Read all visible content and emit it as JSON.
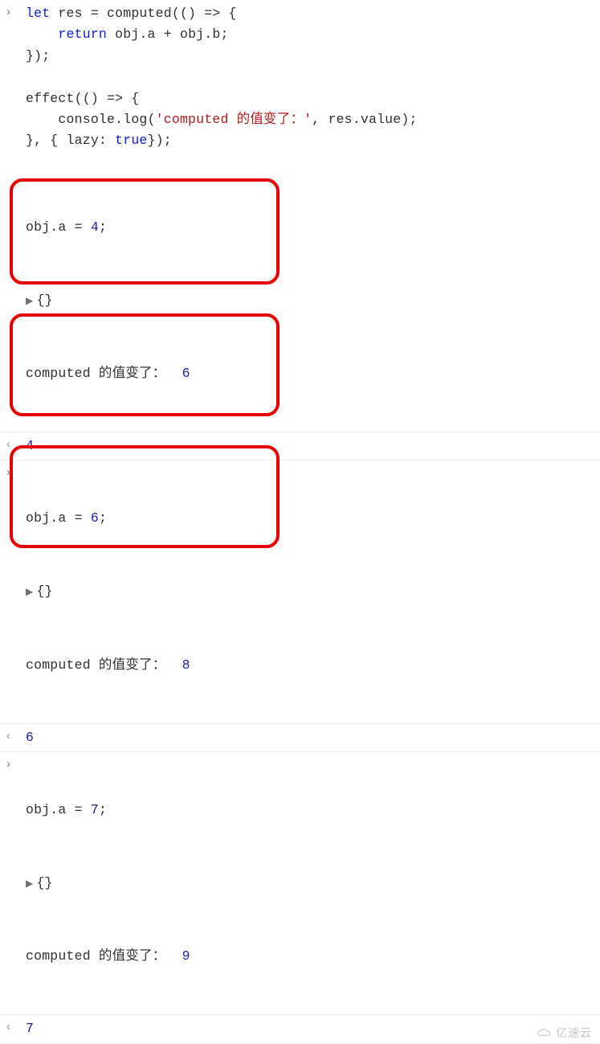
{
  "code_block": {
    "line1_let": "let",
    "line1_rest": " res = computed(() => {",
    "line2_return": "return",
    "line2_rest": " obj.a + obj.b;",
    "line3": "});",
    "line5": "effect(() => {",
    "line6_a": "    console.log(",
    "line6_str": "'computed 的值变了：'",
    "line6_b": ", res.value);",
    "line7_a": "}, { lazy: ",
    "line7_true": "true",
    "line7_b": "});"
  },
  "groups": [
    {
      "assign_lhs": "obj.a = ",
      "assign_val": "4",
      "assign_semi": ";",
      "object_expand": "{}",
      "log_text": "computed 的值变了：  ",
      "log_val": "6",
      "return_val": "4"
    },
    {
      "assign_lhs": "obj.a = ",
      "assign_val": "6",
      "assign_semi": ";",
      "object_expand": "{}",
      "log_text": "computed 的值变了：  ",
      "log_val": "8",
      "return_val": "6"
    },
    {
      "assign_lhs": "obj.a = ",
      "assign_val": "7",
      "assign_semi": ";",
      "object_expand": "{}",
      "log_text": "computed 的值变了：  ",
      "log_val": "9",
      "return_val": "7"
    }
  ],
  "watermark_text": "亿速云"
}
